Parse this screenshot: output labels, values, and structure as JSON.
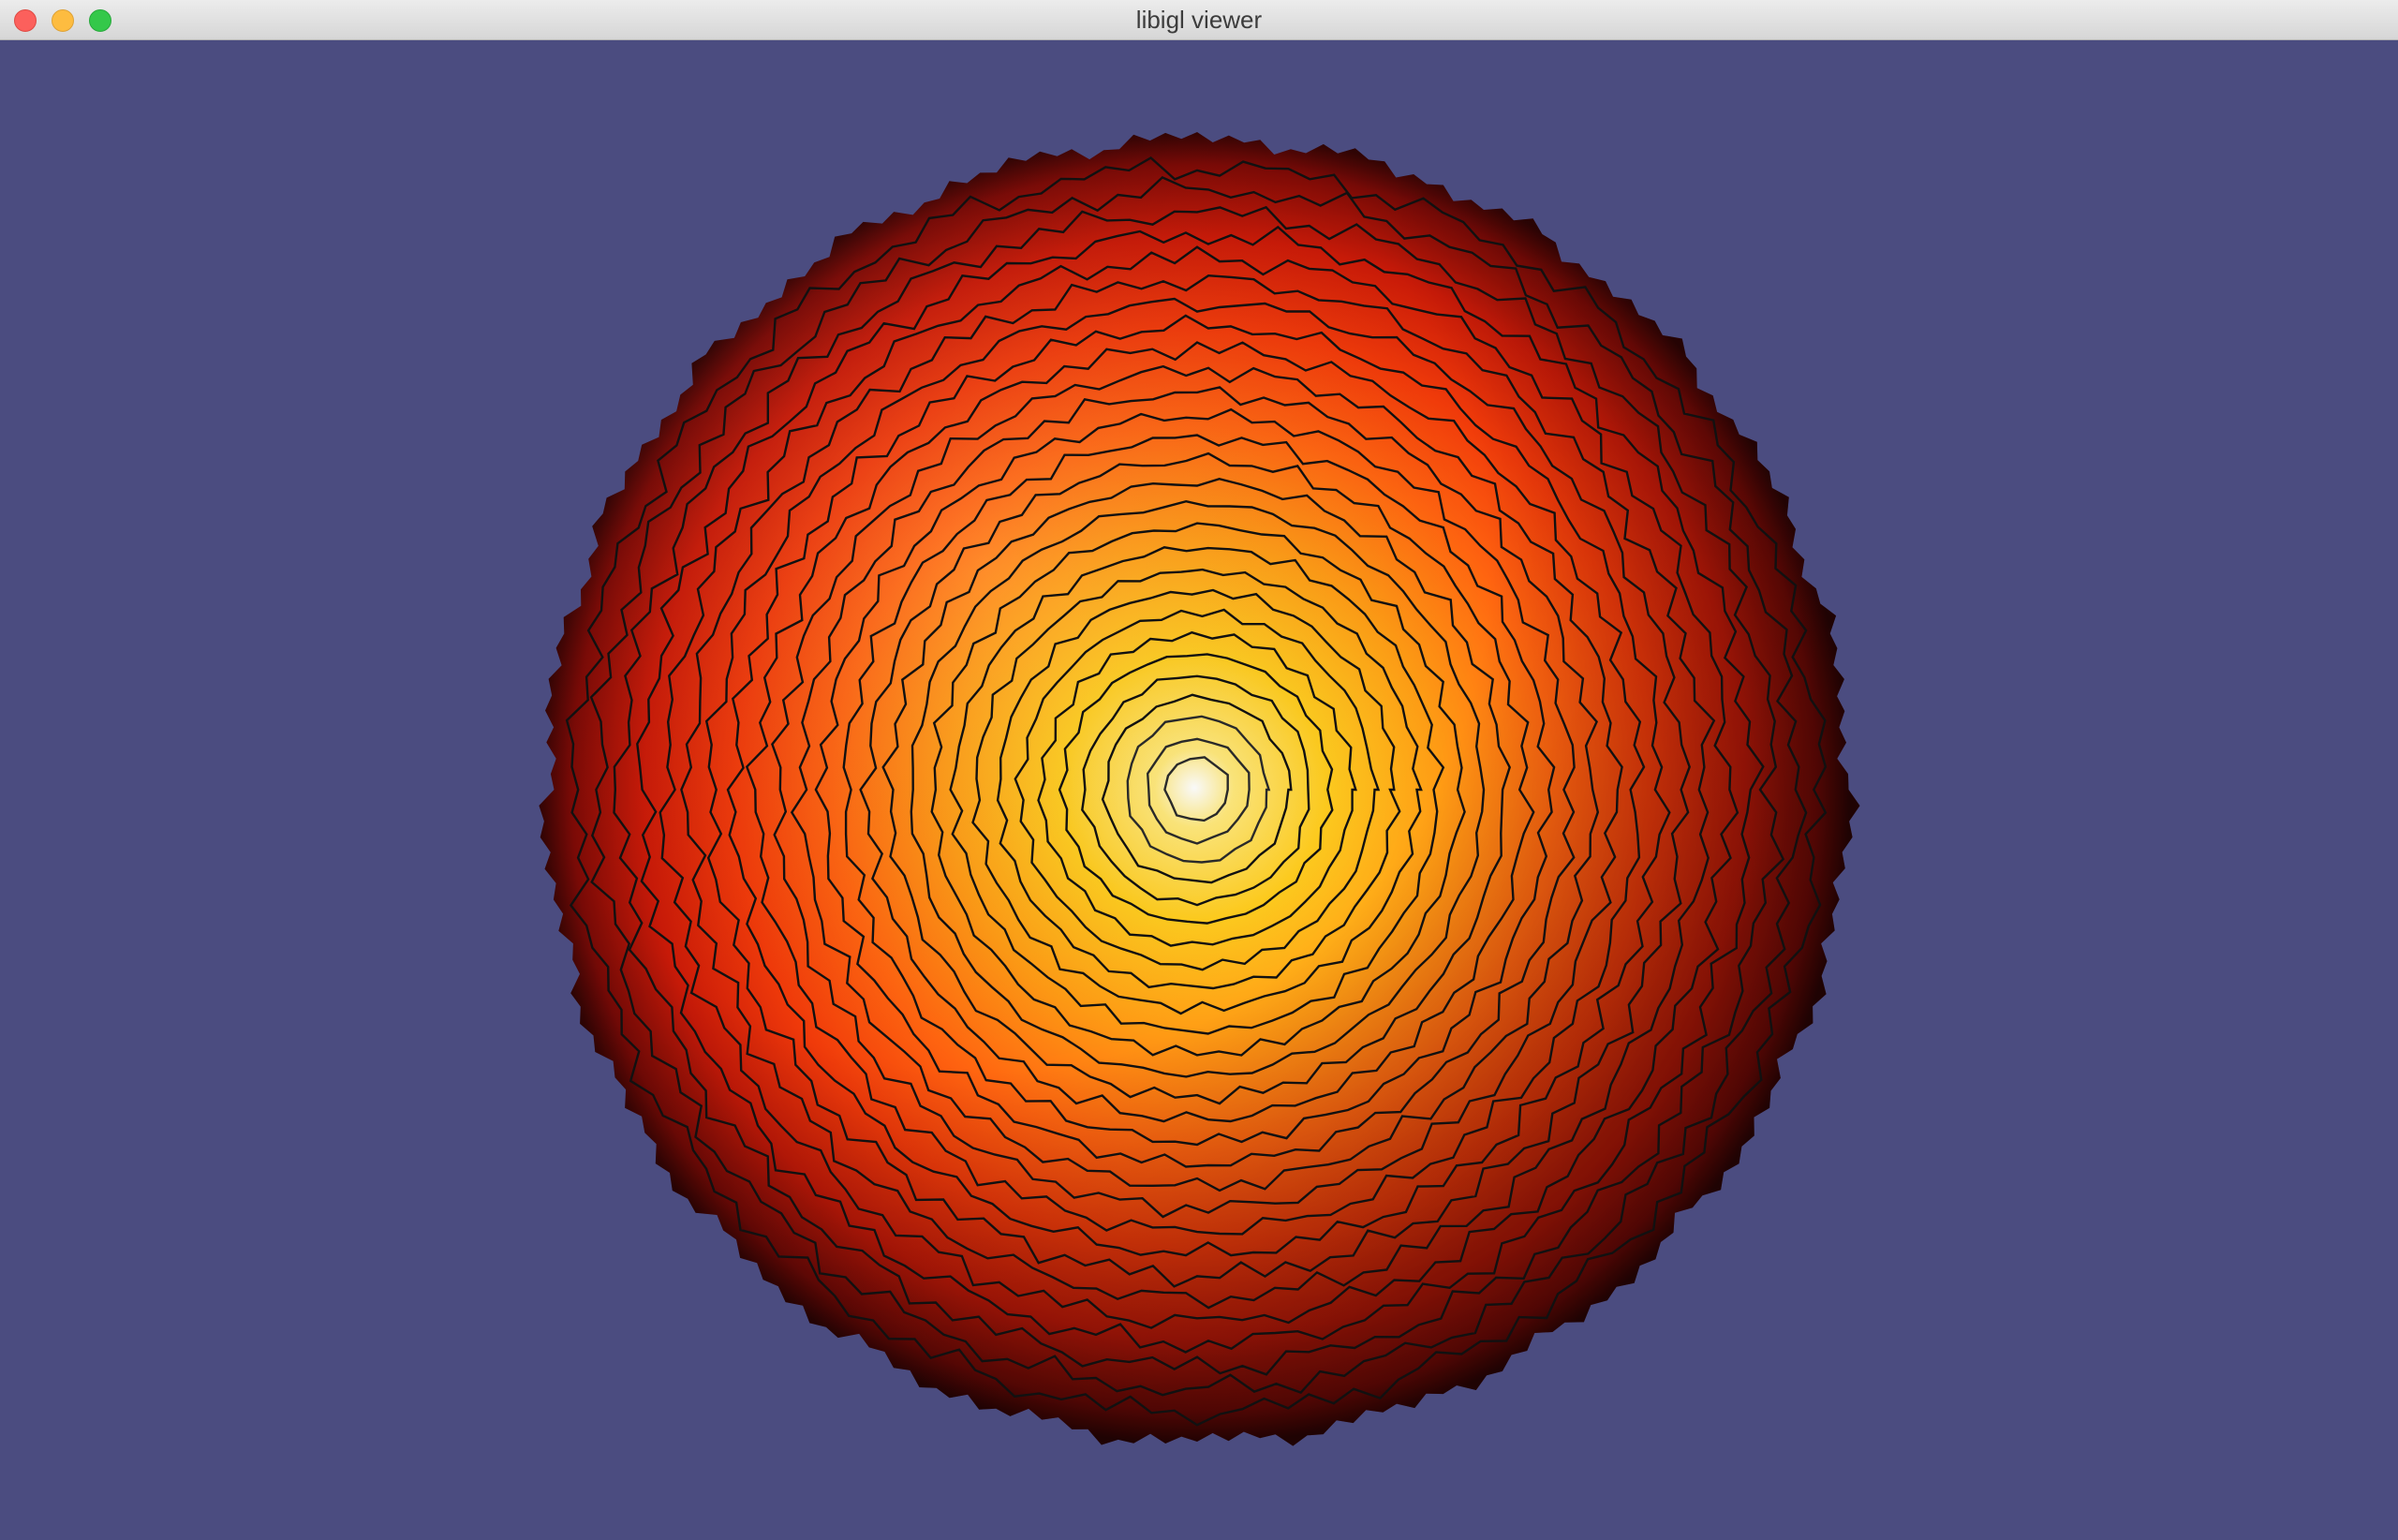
{
  "window": {
    "title": "libigl viewer",
    "controls": [
      {
        "name": "close-button",
        "color": "#fc605c"
      },
      {
        "name": "minimize-button",
        "color": "#fdbc40"
      },
      {
        "name": "zoom-button",
        "color": "#34c84a"
      }
    ]
  },
  "viewport": {
    "background_color": "#4b4c80",
    "mesh": {
      "shape": "noisy sphere",
      "colormap": [
        "#ffffff",
        "#ffe87a",
        "#ffcc1e",
        "#ff9a14",
        "#ff6410",
        "#f03a0a",
        "#c81a08",
        "#7a0a06",
        "#300404"
      ],
      "isoline_color": "#111111",
      "isoline_count": 28
    }
  }
}
